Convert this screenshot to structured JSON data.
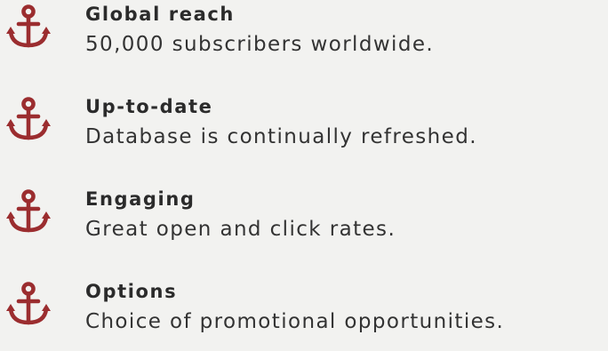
{
  "colors": {
    "background": "#f2f2f0",
    "accent": "#9b2d2f",
    "title_text": "#2b2b2b",
    "body_text": "#333333"
  },
  "features": [
    {
      "icon": "anchor-icon",
      "title": "Global reach",
      "description": "50,000 subscribers worldwide."
    },
    {
      "icon": "anchor-icon",
      "title": "Up-to-date",
      "description": "Database is continually refreshed."
    },
    {
      "icon": "anchor-icon",
      "title": "Engaging",
      "description": "Great open and click rates."
    },
    {
      "icon": "anchor-icon",
      "title": "Options",
      "description": "Choice of promotional opportunities."
    }
  ]
}
